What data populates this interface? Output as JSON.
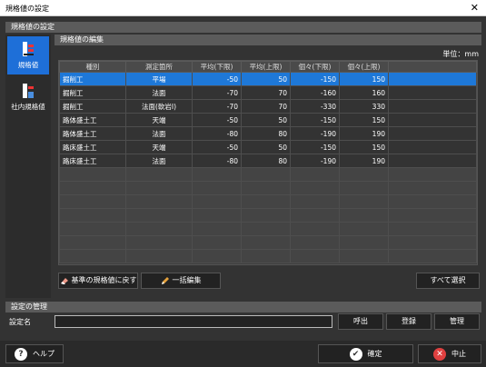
{
  "window": {
    "title": "規格値の設定",
    "close": "✕"
  },
  "section1": {
    "title": "規格値の設定"
  },
  "sidebar": {
    "items": [
      {
        "label": "規格値"
      },
      {
        "label": "社内規格値"
      }
    ]
  },
  "editor": {
    "title": "規格値の編集",
    "unit": "単位：mm"
  },
  "table": {
    "headers": [
      "種別",
      "測定箇所",
      "平均(下限)",
      "平均(上限)",
      "個々(下限)",
      "個々(上限)"
    ],
    "rows": [
      [
        "掘削工",
        "平場",
        "-50",
        "50",
        "-150",
        "150"
      ],
      [
        "掘削工",
        "法面",
        "-70",
        "70",
        "-160",
        "160"
      ],
      [
        "掘削工",
        "法面(軟岩I)",
        "-70",
        "70",
        "-330",
        "330"
      ],
      [
        "路体盛土工",
        "天端",
        "-50",
        "50",
        "-150",
        "150"
      ],
      [
        "路体盛土工",
        "法面",
        "-80",
        "80",
        "-190",
        "190"
      ],
      [
        "路床盛土工",
        "天端",
        "-50",
        "50",
        "-150",
        "150"
      ],
      [
        "路床盛土工",
        "法面",
        "-80",
        "80",
        "-190",
        "190"
      ]
    ]
  },
  "buttons": {
    "reset": "基準の規格値に戻す",
    "bulk_edit": "一括編集",
    "select_all": "すべて選択",
    "load": "呼出",
    "register": "登録",
    "manage": "管理",
    "help": "ヘルプ",
    "ok": "確定",
    "cancel": "中止"
  },
  "settings": {
    "title": "設定の管理",
    "name_label": "設定名",
    "name_value": ""
  }
}
